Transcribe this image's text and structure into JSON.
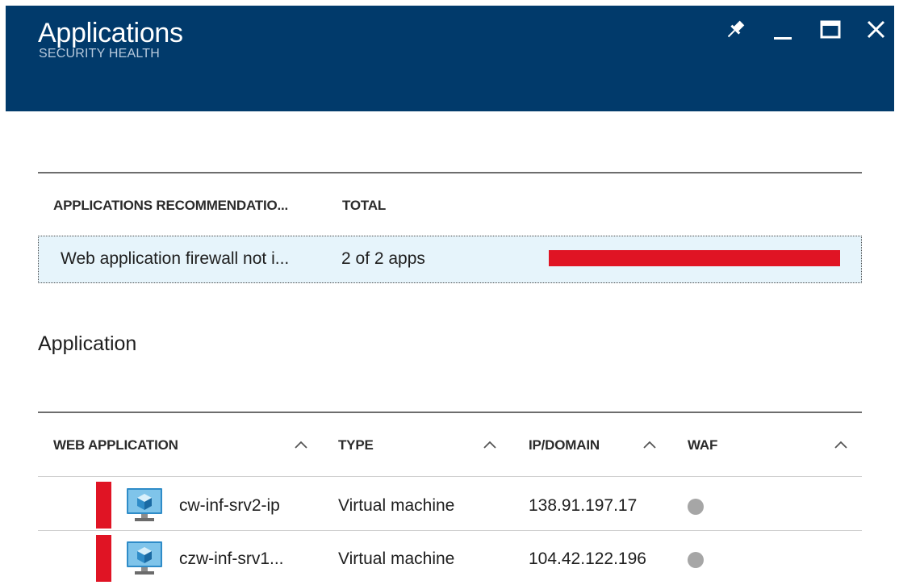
{
  "blade": {
    "title": "Applications",
    "subtitle": "SECURITY HEALTH",
    "actions": [
      "pin-icon",
      "minimize-icon",
      "maximize-icon",
      "close-icon"
    ],
    "header_color": "#013a6b"
  },
  "recommendations": {
    "columns": [
      "APPLICATIONS RECOMMENDATIO...",
      "TOTAL"
    ],
    "rows": [
      {
        "name": "Web application firewall not i...",
        "total": "2 of 2 apps",
        "severity": "high",
        "bar_fraction": 1.0,
        "bar_color": "#e01424"
      }
    ]
  },
  "applications": {
    "title": "Application",
    "columns": [
      "WEB APPLICATION",
      "TYPE",
      "IP/DOMAIN",
      "WAF"
    ],
    "rows": [
      {
        "name": "cw-inf-srv2-ip",
        "type": "Virtual machine",
        "ip": "138.91.197.17",
        "waf": "grey",
        "icon": "virtual-machine-icon",
        "severity_color": "#e01424"
      },
      {
        "name": "czw-inf-srv1...",
        "type": "Virtual machine",
        "ip": "104.42.122.196",
        "waf": "grey",
        "icon": "virtual-machine-icon",
        "severity_color": "#e01424"
      }
    ]
  }
}
